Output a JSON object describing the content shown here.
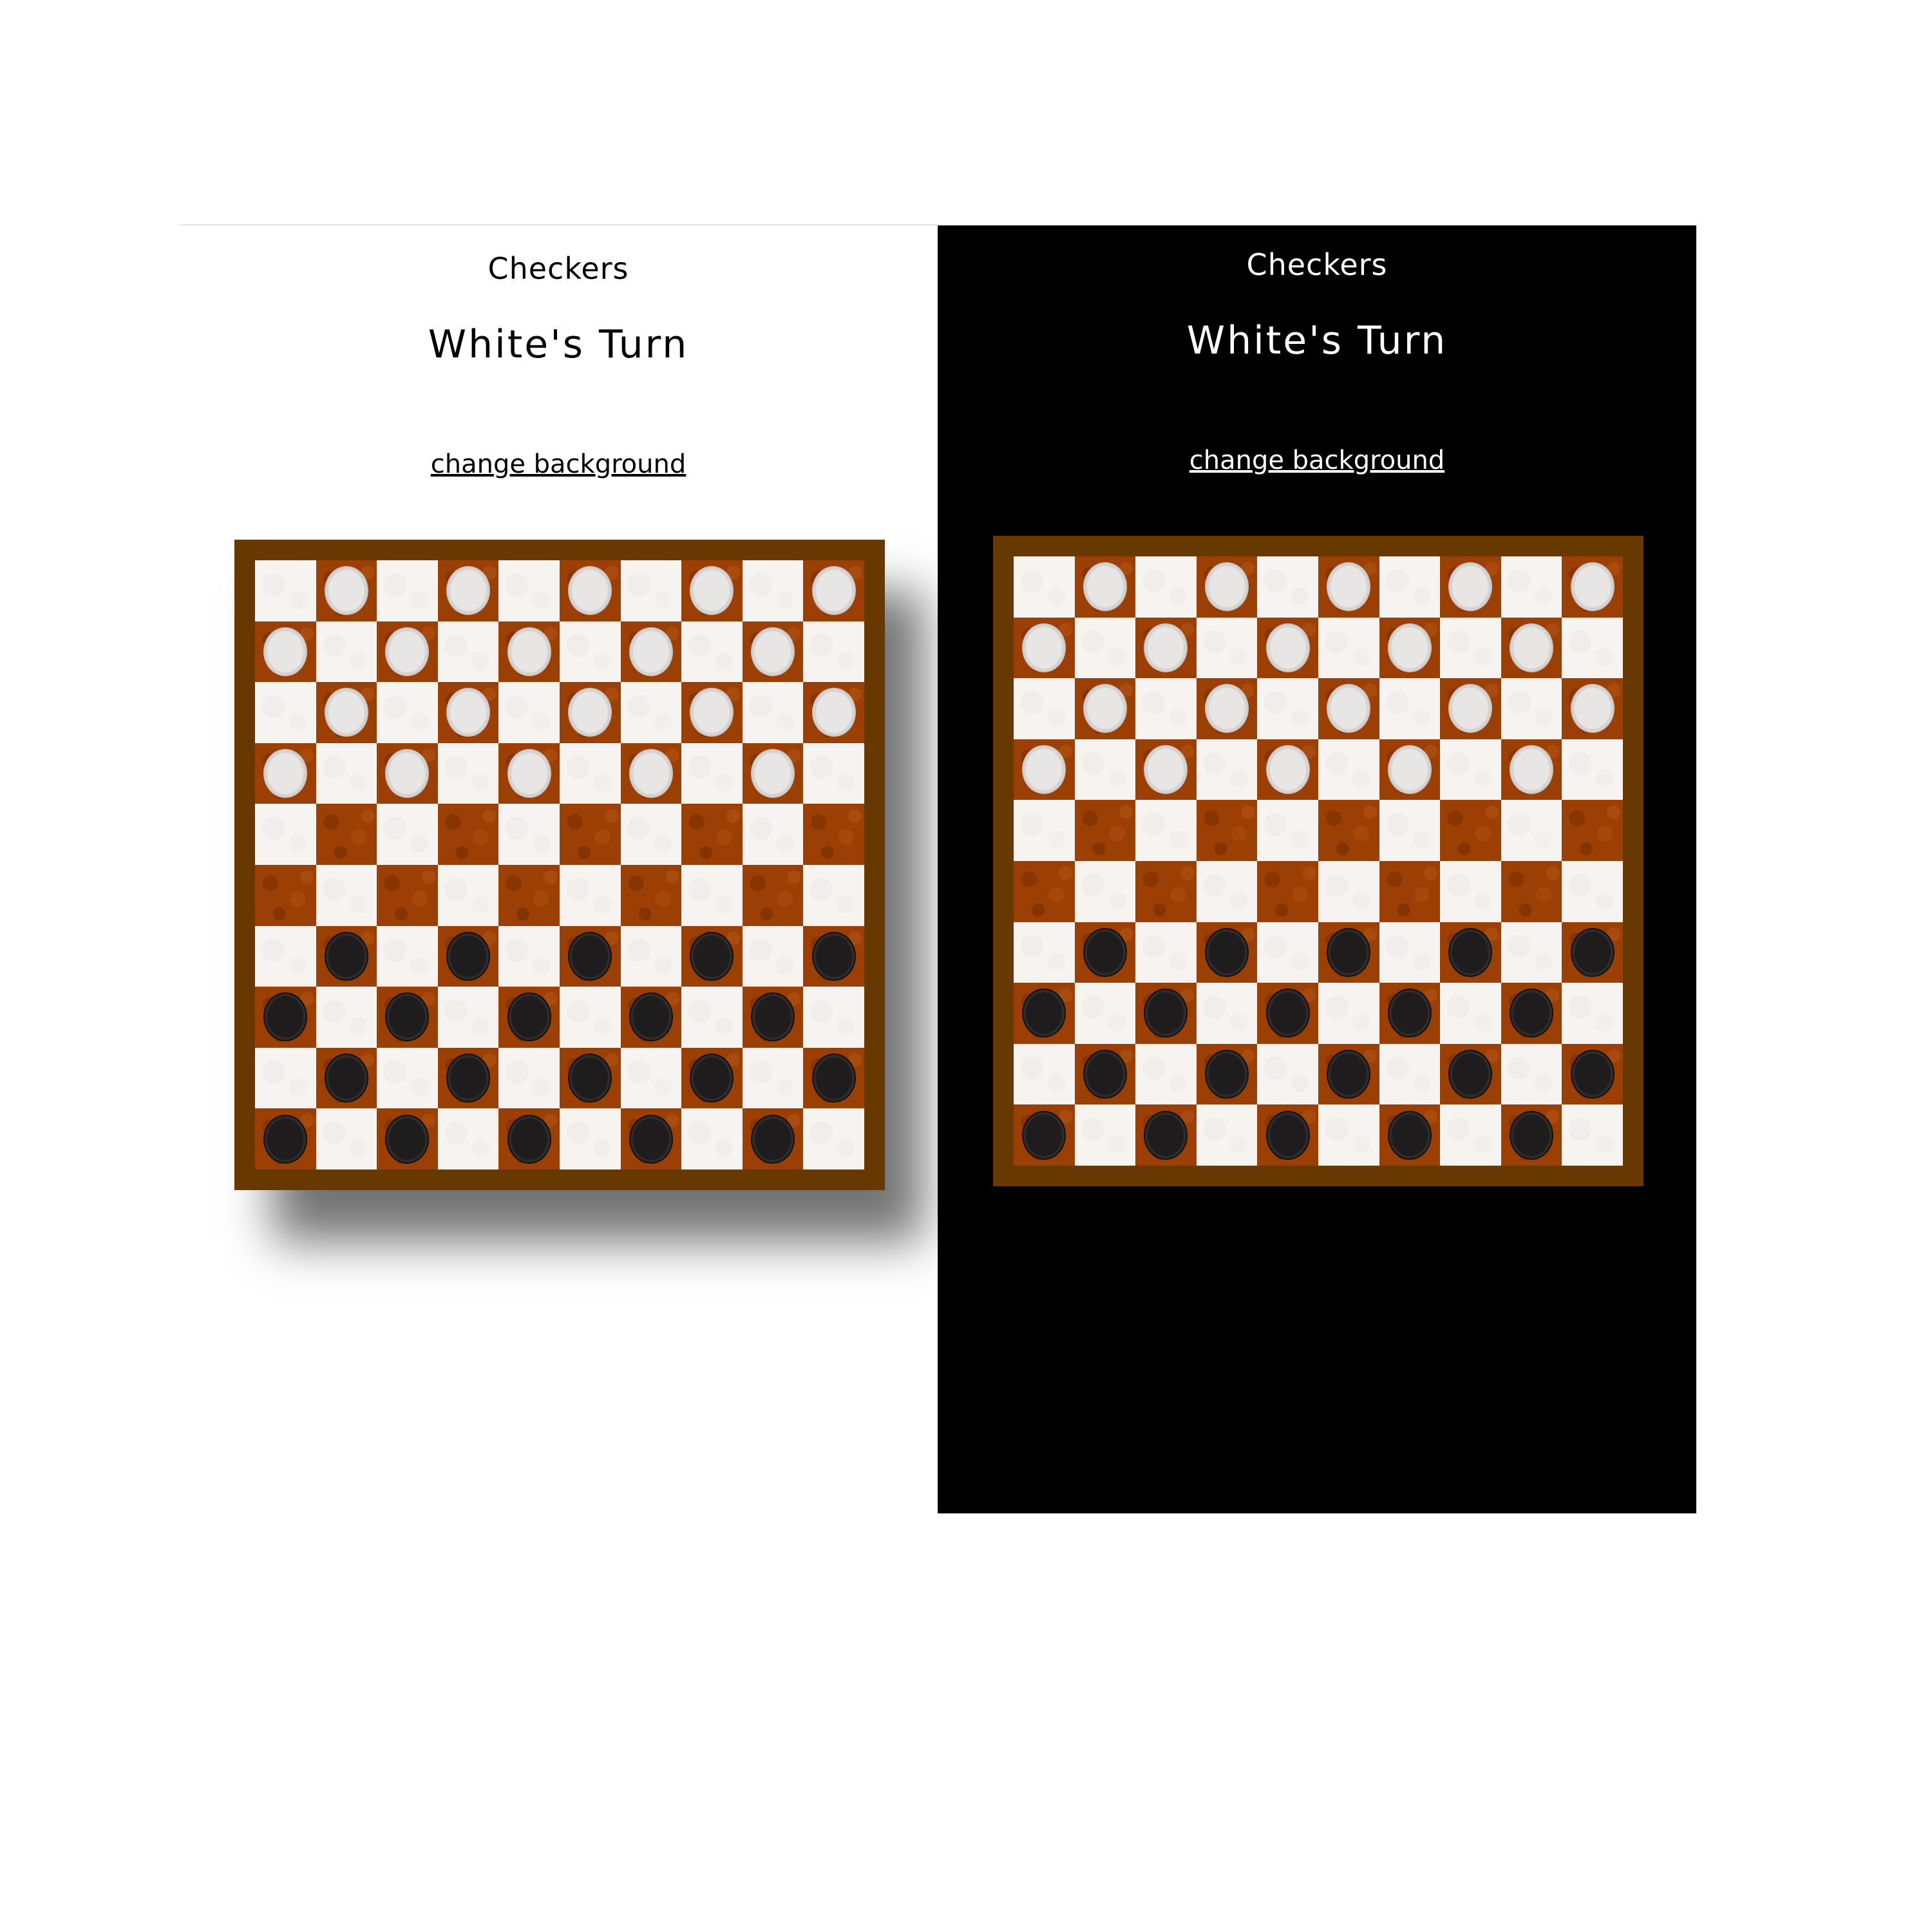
{
  "panels": [
    {
      "theme": "light",
      "title": "Checkers",
      "turn_text": "White's Turn",
      "link_label": "change background",
      "background_color": "#ffffff"
    },
    {
      "theme": "dark",
      "title": "Checkers",
      "turn_text": "White's Turn",
      "link_label": "change background",
      "background_color": "#000000"
    }
  ],
  "board": {
    "rows": 10,
    "cols": 10,
    "frame_color": "#673800",
    "light_square_color": "#f6f3f1",
    "dark_square_color": "#9b3f05",
    "white_piece_color": "#e8e6e5",
    "black_piece_color": "#1e1c1c",
    "layout": [
      "-w-w-w-w-w",
      "w-w-w-w-w-",
      "-w-w-w-w-w",
      "w-w-w-w-w-",
      "----------",
      "----------",
      "-b-b-b-b-b",
      "b-b-b-b-b-",
      "-b-b-b-b-b",
      "b-b-b-b-b-"
    ]
  }
}
